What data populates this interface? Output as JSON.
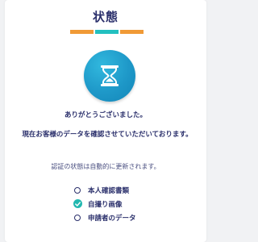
{
  "title": "状態",
  "progress": {
    "segments": [
      {
        "color": "#f09a36"
      },
      {
        "color": "#22c0c0"
      },
      {
        "color": "#f09a36"
      }
    ]
  },
  "hero_icon": "hourglass-icon",
  "messages": {
    "thanks": "ありがとうございました。",
    "confirming": "現在お客様のデータを確認させていただいております。",
    "auto_update": "認証の状態は自動的に更新されます。"
  },
  "checklist": [
    {
      "label": "本人確認書類",
      "status": "pending"
    },
    {
      "label": "自撮り画像",
      "status": "done"
    },
    {
      "label": "申請者のデータ",
      "status": "pending"
    }
  ],
  "colors": {
    "text": "#2a2f6b",
    "accent_teal": "#22b8b0",
    "hero_blue": "#1e98c8"
  }
}
